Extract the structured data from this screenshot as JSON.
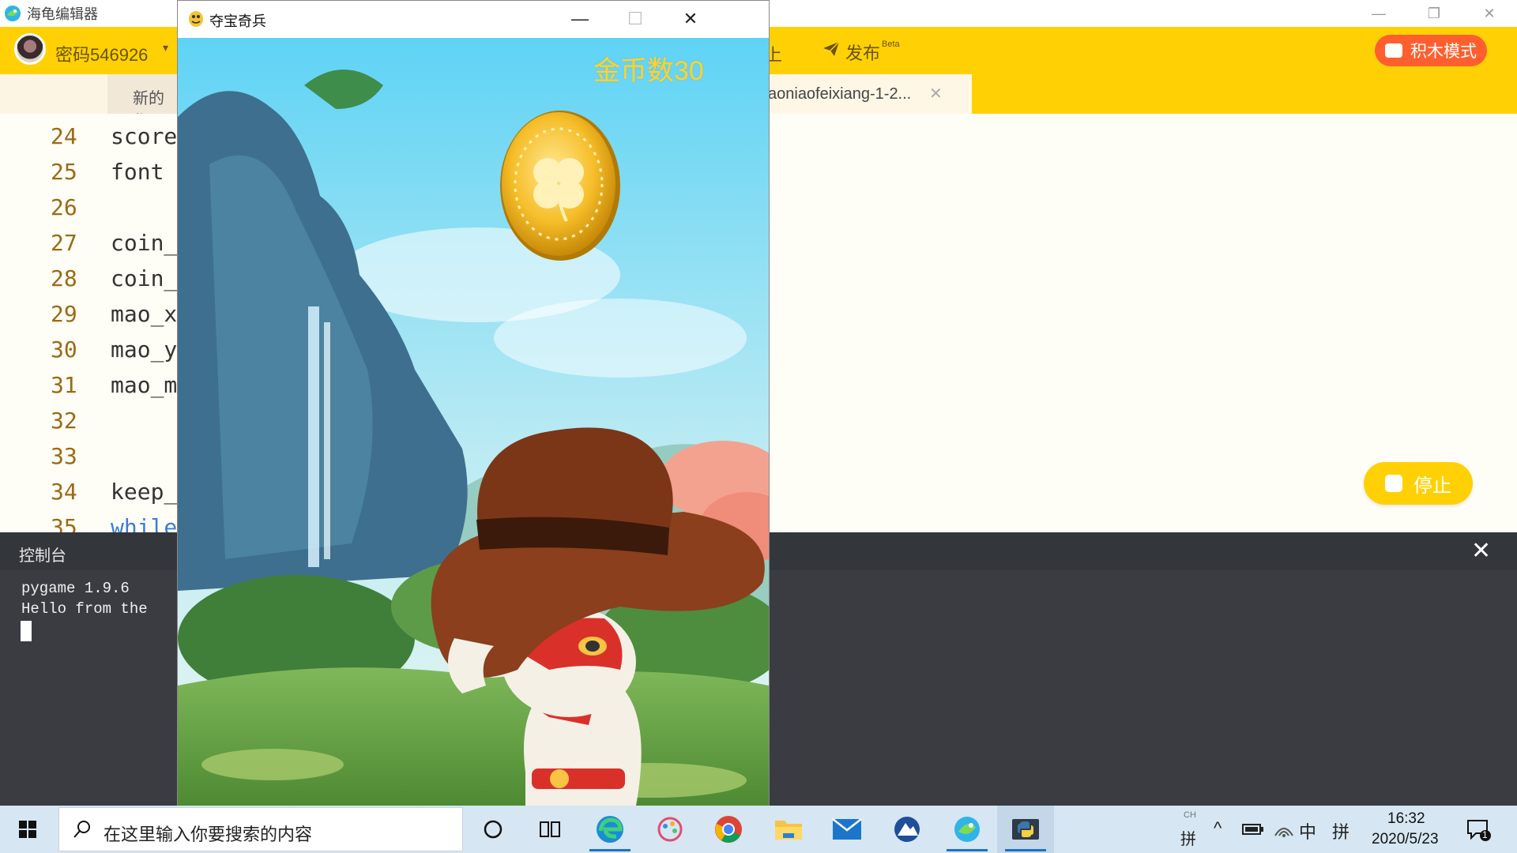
{
  "editor": {
    "app_title": "海龟编辑器",
    "user_name": "密码546926",
    "toolbar_partial": "上",
    "publish_label": "发布",
    "publish_badge": "Beta",
    "block_mode_label": "积木模式",
    "tabs": [
      {
        "label": "新的作"
      },
      {
        "label": "aoniaofeixiang-1-2..."
      }
    ],
    "code_lines": [
      {
        "num": "24",
        "text": "score"
      },
      {
        "num": "25",
        "text": "font"
      },
      {
        "num": "26",
        "text": ""
      },
      {
        "num": "27",
        "text": "coin_"
      },
      {
        "num": "28",
        "text": "coin_"
      },
      {
        "num": "29",
        "text": "mao_x"
      },
      {
        "num": "30",
        "text": "mao_y"
      },
      {
        "num": "31",
        "text": "mao_m"
      },
      {
        "num": "32",
        "text": ""
      },
      {
        "num": "33",
        "text": ""
      },
      {
        "num": "34",
        "text": "keep_"
      },
      {
        "num": "35",
        "text": "while"
      }
    ],
    "stop_label": "停止"
  },
  "console": {
    "title": "控制台",
    "lines": [
      "pygame 1.9.6",
      "Hello from the"
    ]
  },
  "game": {
    "window_title": "夺宝奇兵",
    "coin_label": "金币数30"
  },
  "taskbar": {
    "search_placeholder": "在这里输入你要搜索的内容",
    "ime_mode": "中",
    "ime_pinyin": "拼",
    "ime_small_top": "CH",
    "time": "16:32",
    "date": "2020/5/23",
    "notifications": "1"
  },
  "colors": {
    "toolbar_yellow": "#FFD105",
    "block_mode_orange": "#FF5E2E",
    "console_bg": "#3A3C42",
    "coin_text": "#FFD22E"
  }
}
